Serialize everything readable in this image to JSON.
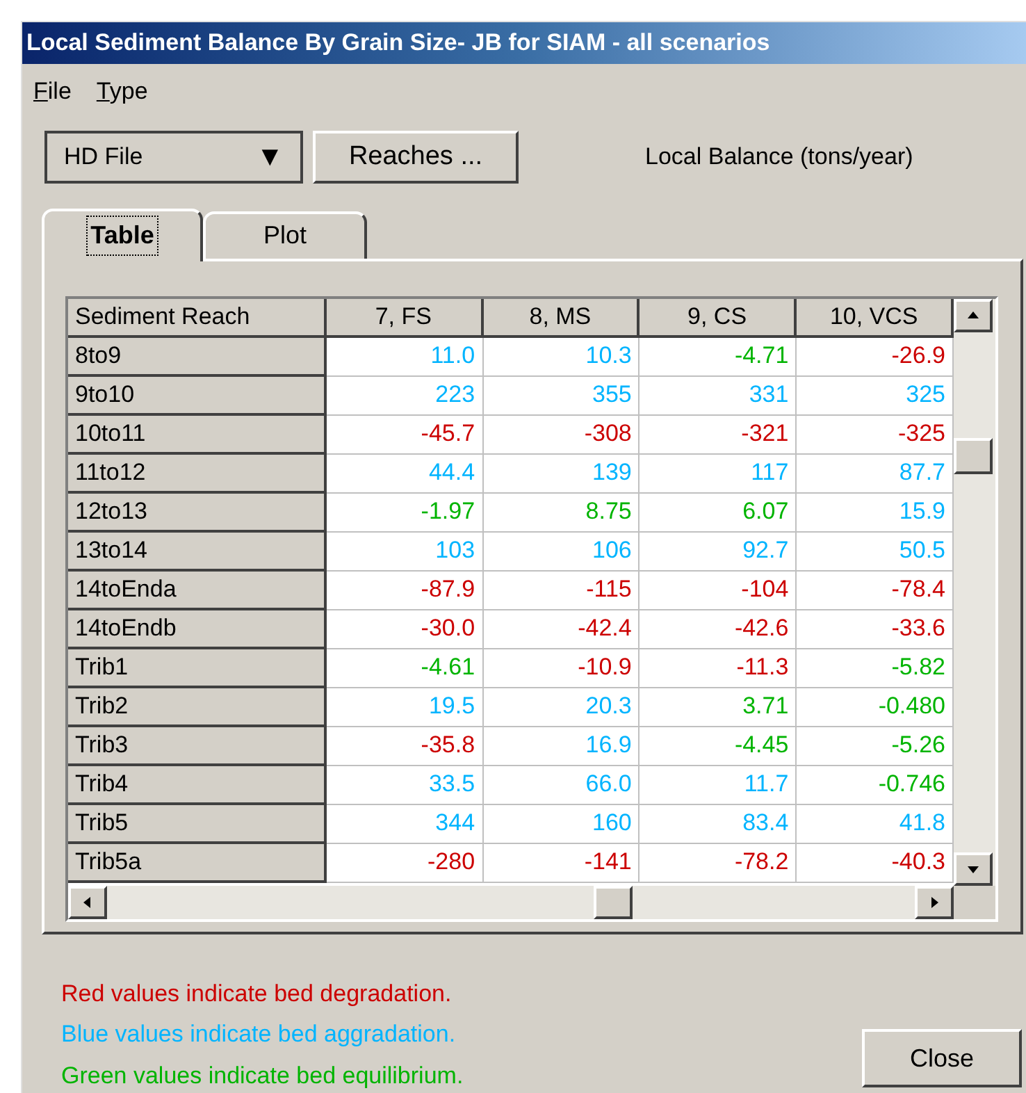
{
  "window": {
    "title": "Local Sediment Balance By Grain Size- JB for SIAM - all scenarios"
  },
  "menu": [
    {
      "label": "File"
    },
    {
      "label": "Type"
    }
  ],
  "toolbar": {
    "dropdown": {
      "value": "HD File",
      "arrow": "▼"
    },
    "button": "Reaches ...",
    "units_label": "Local Balance (tons/year)"
  },
  "tabs": [
    {
      "label": "Table",
      "selected": true
    },
    {
      "label": "Plot",
      "selected": false
    }
  ],
  "table": {
    "columns": [
      "Sediment Reach",
      "7, FS",
      "8, MS",
      "9, CS",
      "10, VCS"
    ],
    "rows": [
      {
        "reach": "8to9",
        "cells": [
          {
            "text": "11.0",
            "color": "#00b4ff"
          },
          {
            "text": "10.3",
            "color": "#00b4ff"
          },
          {
            "text": "-4.71",
            "color": "#00b400"
          },
          {
            "text": "-26.9",
            "color": "#cc0000"
          }
        ]
      },
      {
        "reach": "9to10",
        "cells": [
          {
            "text": "223",
            "color": "#00b4ff"
          },
          {
            "text": "355",
            "color": "#00b4ff"
          },
          {
            "text": "331",
            "color": "#00b4ff"
          },
          {
            "text": "325",
            "color": "#00b4ff"
          }
        ]
      },
      {
        "reach": "10to11",
        "cells": [
          {
            "text": "-45.7",
            "color": "#cc0000"
          },
          {
            "text": "-308",
            "color": "#cc0000"
          },
          {
            "text": "-321",
            "color": "#cc0000"
          },
          {
            "text": "-325",
            "color": "#cc0000"
          }
        ]
      },
      {
        "reach": "11to12",
        "cells": [
          {
            "text": "44.4",
            "color": "#00b4ff"
          },
          {
            "text": "139",
            "color": "#00b4ff"
          },
          {
            "text": "117",
            "color": "#00b4ff"
          },
          {
            "text": "87.7",
            "color": "#00b4ff"
          }
        ]
      },
      {
        "reach": "12to13",
        "cells": [
          {
            "text": "-1.97",
            "color": "#00b400"
          },
          {
            "text": "8.75",
            "color": "#00b400"
          },
          {
            "text": "6.07",
            "color": "#00b400"
          },
          {
            "text": "15.9",
            "color": "#00b4ff"
          }
        ]
      },
      {
        "reach": "13to14",
        "cells": [
          {
            "text": "103",
            "color": "#00b4ff"
          },
          {
            "text": "106",
            "color": "#00b4ff"
          },
          {
            "text": "92.7",
            "color": "#00b4ff"
          },
          {
            "text": "50.5",
            "color": "#00b4ff"
          }
        ]
      },
      {
        "reach": "14toEnda",
        "cells": [
          {
            "text": "-87.9",
            "color": "#cc0000"
          },
          {
            "text": "-115",
            "color": "#cc0000"
          },
          {
            "text": "-104",
            "color": "#cc0000"
          },
          {
            "text": "-78.4",
            "color": "#cc0000"
          }
        ]
      },
      {
        "reach": "14toEndb",
        "cells": [
          {
            "text": "-30.0",
            "color": "#cc0000"
          },
          {
            "text": "-42.4",
            "color": "#cc0000"
          },
          {
            "text": "-42.6",
            "color": "#cc0000"
          },
          {
            "text": "-33.6",
            "color": "#cc0000"
          }
        ]
      },
      {
        "reach": "Trib1",
        "cells": [
          {
            "text": "-4.61",
            "color": "#00b400"
          },
          {
            "text": "-10.9",
            "color": "#cc0000"
          },
          {
            "text": "-11.3",
            "color": "#cc0000"
          },
          {
            "text": "-5.82",
            "color": "#00b400"
          }
        ]
      },
      {
        "reach": "Trib2",
        "cells": [
          {
            "text": "19.5",
            "color": "#00b4ff"
          },
          {
            "text": "20.3",
            "color": "#00b4ff"
          },
          {
            "text": "3.71",
            "color": "#00b400"
          },
          {
            "text": "-0.480",
            "color": "#00b400"
          }
        ]
      },
      {
        "reach": "Trib3",
        "cells": [
          {
            "text": "-35.8",
            "color": "#cc0000"
          },
          {
            "text": "16.9",
            "color": "#00b4ff"
          },
          {
            "text": "-4.45",
            "color": "#00b400"
          },
          {
            "text": "-5.26",
            "color": "#00b400"
          }
        ]
      },
      {
        "reach": "Trib4",
        "cells": [
          {
            "text": "33.5",
            "color": "#00b4ff"
          },
          {
            "text": "66.0",
            "color": "#00b4ff"
          },
          {
            "text": "11.7",
            "color": "#00b4ff"
          },
          {
            "text": "-0.746",
            "color": "#00b400"
          }
        ]
      },
      {
        "reach": "Trib5",
        "cells": [
          {
            "text": "344",
            "color": "#00b4ff"
          },
          {
            "text": "160",
            "color": "#00b4ff"
          },
          {
            "text": "83.4",
            "color": "#00b4ff"
          },
          {
            "text": "41.8",
            "color": "#00b4ff"
          }
        ]
      },
      {
        "reach": "Trib5a",
        "cells": [
          {
            "text": "-280",
            "color": "#cc0000"
          },
          {
            "text": "-141",
            "color": "#cc0000"
          },
          {
            "text": "-78.2",
            "color": "#cc0000"
          },
          {
            "text": "-40.3",
            "color": "#cc0000"
          }
        ]
      }
    ]
  },
  "legend": [
    {
      "text": "Red values indicate bed degradation.",
      "color": "#cc0000"
    },
    {
      "text": "Blue values indicate bed aggradation.",
      "color": "#00b4ff"
    },
    {
      "text": "Green values indicate bed equilibrium.",
      "color": "#00b400"
    }
  ],
  "close_button": "Close"
}
